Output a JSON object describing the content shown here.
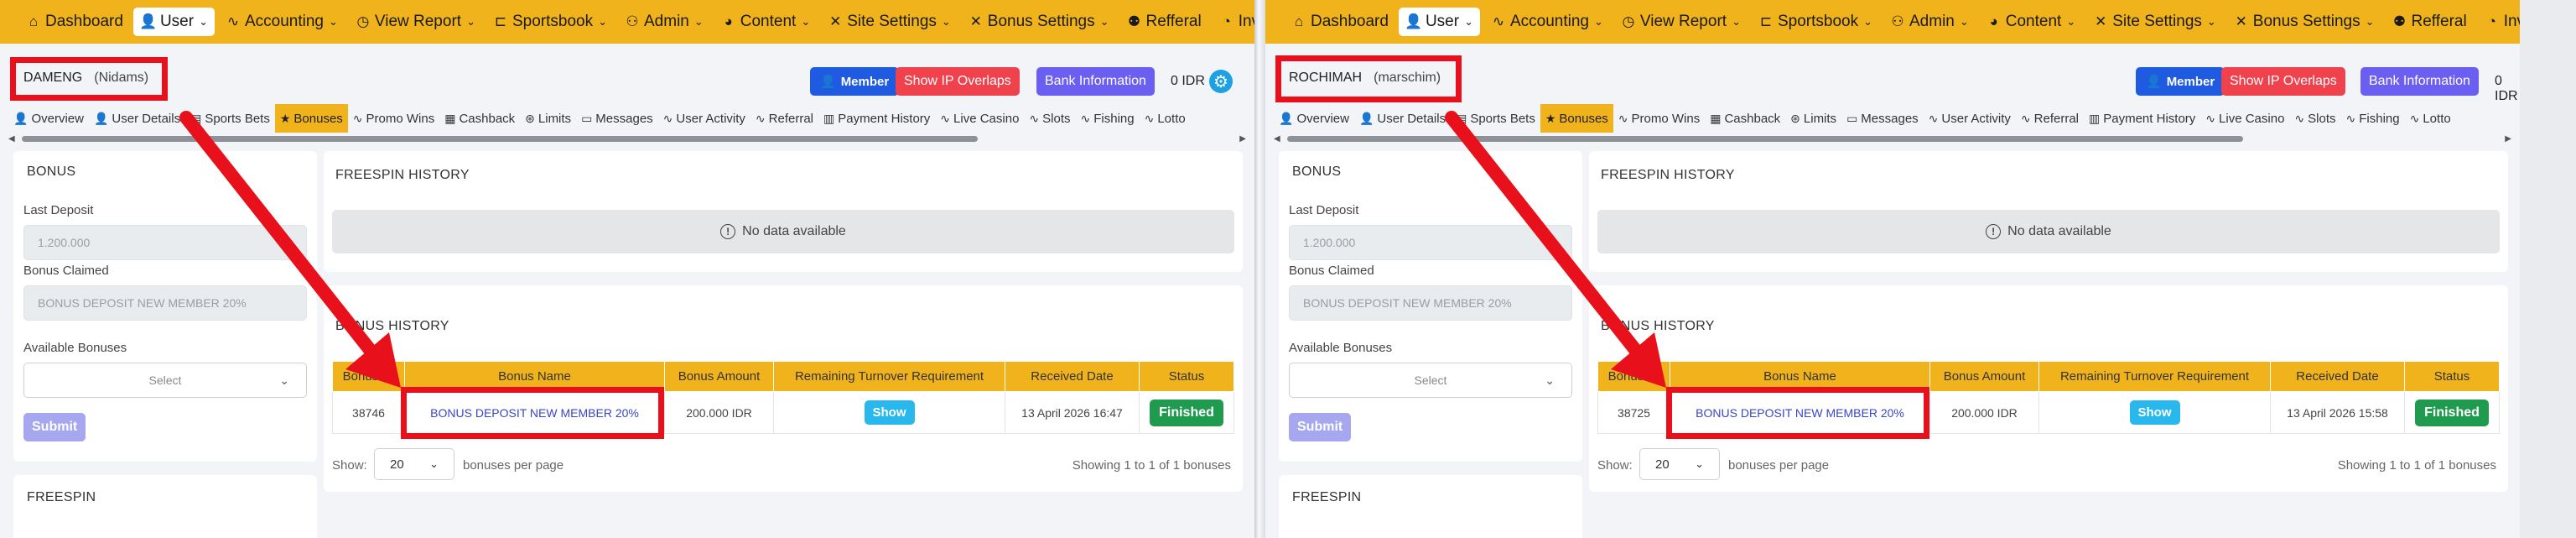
{
  "nav": {
    "items": [
      {
        "label": "Dashboard",
        "icon": "home-icon",
        "glyph": "⌂"
      },
      {
        "label": "User",
        "icon": "user-icon",
        "glyph": "👤",
        "active": true,
        "dropdown": true
      },
      {
        "label": "Accounting",
        "icon": "pulse-icon",
        "glyph": "∿",
        "dropdown": true
      },
      {
        "label": "View Report",
        "icon": "clock-icon",
        "glyph": "◷",
        "dropdown": true
      },
      {
        "label": "Sportsbook",
        "icon": "tournament-icon",
        "glyph": "⊏",
        "dropdown": true
      },
      {
        "label": "Admin",
        "icon": "admin-icon",
        "glyph": "⚇",
        "dropdown": true
      },
      {
        "label": "Content",
        "icon": "palette-icon",
        "glyph": "◕",
        "dropdown": true
      },
      {
        "label": "Site Settings",
        "icon": "tools-icon",
        "glyph": "✕",
        "dropdown": true
      },
      {
        "label": "Bonus Settings",
        "icon": "tools-icon",
        "glyph": "✕",
        "dropdown": true
      },
      {
        "label": "Refferal",
        "icon": "referral-icon",
        "glyph": "⚉"
      },
      {
        "label": "Invoice",
        "icon": "gauge-icon",
        "glyph": "◔",
        "dropdown": true
      }
    ]
  },
  "header_buttons": {
    "member": "Member",
    "ip_overlaps": "Show IP Overlaps",
    "bank_info": "Bank Information",
    "balance": "0 IDR"
  },
  "subtabs": [
    {
      "label": "Overview",
      "icon": "user-icon",
      "glyph": "👤"
    },
    {
      "label": "User Details",
      "icon": "user-icon",
      "glyph": "👤"
    },
    {
      "label": "Sports Bets",
      "icon": "document-icon",
      "glyph": "▤"
    },
    {
      "label": "Bonuses",
      "icon": "star-icon",
      "glyph": "★",
      "active": true
    },
    {
      "label": "Promo Wins",
      "icon": "pulse-icon",
      "glyph": "∿"
    },
    {
      "label": "Cashback",
      "icon": "gift-icon",
      "glyph": "▦"
    },
    {
      "label": "Limits",
      "icon": "ball-icon",
      "glyph": "⊛"
    },
    {
      "label": "Messages",
      "icon": "chat-icon",
      "glyph": "▭"
    },
    {
      "label": "User Activity",
      "icon": "pulse-icon",
      "glyph": "∿"
    },
    {
      "label": "Referral",
      "icon": "pulse-icon",
      "glyph": "∿"
    },
    {
      "label": "Payment History",
      "icon": "table-icon",
      "glyph": "▥"
    },
    {
      "label": "Live Casino",
      "icon": "pulse-icon",
      "glyph": "∿"
    },
    {
      "label": "Slots",
      "icon": "pulse-icon",
      "glyph": "∿"
    },
    {
      "label": "Fishing",
      "icon": "pulse-icon",
      "glyph": "∿"
    },
    {
      "label": "Lotto",
      "icon": "pulse-icon",
      "glyph": "∿"
    }
  ],
  "bonus_card": {
    "title": "BONUS",
    "last_deposit_label": "Last Deposit",
    "bonus_claimed_label": "Bonus Claimed",
    "available_label": "Available Bonuses",
    "select_placeholder": "Select",
    "submit": "Submit"
  },
  "freespin_card": {
    "title": "FREESPIN"
  },
  "freespin_history": {
    "title": "FREESPIN HISTORY",
    "empty": "No data available"
  },
  "bonus_history": {
    "title": "BONUS HISTORY",
    "columns": [
      "Bonus ID",
      "Bonus Name",
      "Bonus Amount",
      "Remaining Turnover Requirement",
      "Received Date",
      "Status"
    ],
    "show_btn": "Show",
    "status": "Finished",
    "show_label": "Show:",
    "per_page_value": "20",
    "per_page_label": "bonuses per page"
  },
  "left": {
    "username": "DAMENG",
    "nickname": "(Nidams)",
    "last_deposit": "1.200.000",
    "bonus_claimed": "BONUS DEPOSIT NEW MEMBER 20%",
    "row": {
      "id": "38746",
      "name": "BONUS DEPOSIT NEW MEMBER 20%",
      "amount": "200.000 IDR",
      "date": "13 April 2026 16:47"
    },
    "showing": "Showing 1 to 1 of 1 bonuses"
  },
  "right": {
    "username": "ROCHIMAH",
    "nickname": "(marschim)",
    "last_deposit": "1.200.000",
    "bonus_claimed": "BONUS DEPOSIT NEW MEMBER 20%",
    "row": {
      "id": "38725",
      "name": "BONUS DEPOSIT NEW MEMBER 20%",
      "amount": "200.000 IDR",
      "date": "13 April 2026 15:58"
    },
    "showing": "Showing 1 to 1 of 1 bonuses"
  },
  "colors": {
    "nav_bg": "#f1b31b",
    "annotation_red": "#e8111b",
    "member_blue": "#1f5be0",
    "ip_red": "#f0424d",
    "bank_purple": "#6a5ff0",
    "finished_green": "#1f9a4f",
    "show_cyan": "#28b8ec"
  }
}
